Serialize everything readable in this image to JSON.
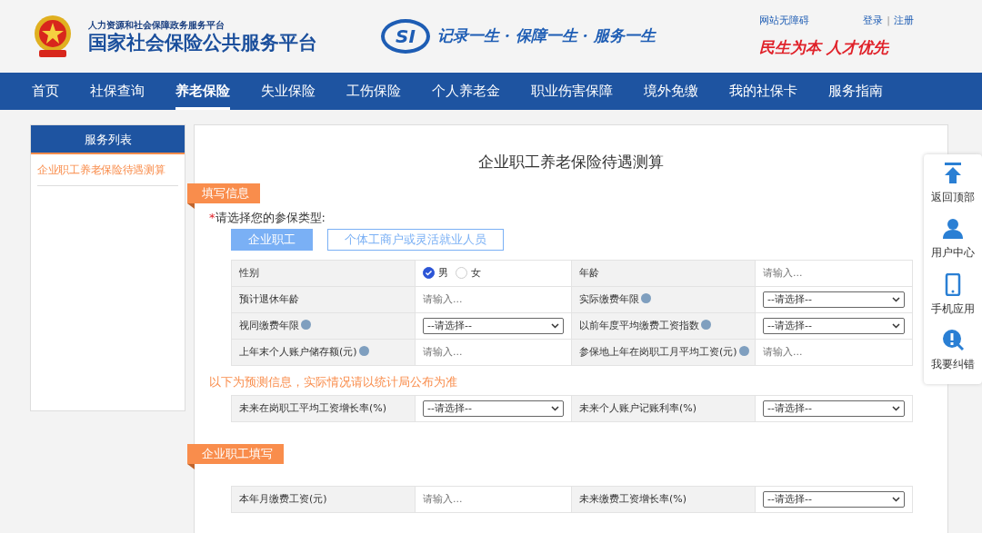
{
  "header": {
    "subtitle": "人力资源和社会保障政务服务平台",
    "title": "国家社会保险公共服务平台",
    "logo_text": "SI",
    "slogan": "记录一生 · 保障一生 · 服务一生",
    "accessibility_link": "网站无障碍",
    "login": "登录",
    "separator": "|",
    "register": "注册",
    "motto": "民生为本 人才优先"
  },
  "nav": [
    {
      "label": "首页",
      "selected": false
    },
    {
      "label": "社保查询",
      "selected": false
    },
    {
      "label": "养老保险",
      "selected": true
    },
    {
      "label": "失业保险",
      "selected": false
    },
    {
      "label": "工伤保险",
      "selected": false
    },
    {
      "label": "个人养老金",
      "selected": false
    },
    {
      "label": "职业伤害保障",
      "selected": false
    },
    {
      "label": "境外免缴",
      "selected": false
    },
    {
      "label": "我的社保卡",
      "selected": false
    },
    {
      "label": "服务指南",
      "selected": false
    }
  ],
  "sidebar": {
    "title": "服务列表",
    "items": [
      {
        "label": "企业职工养老保险待遇测算",
        "selected": true
      }
    ]
  },
  "main": {
    "title": "企业职工养老保险待遇测算",
    "sections": [
      {
        "tag": "填写信息",
        "required_mark": "*",
        "prompt": "请选择您的参保类型:",
        "types": [
          {
            "label": "企业职工",
            "selected": true
          },
          {
            "label": "个体工商户或灵活就业人员",
            "selected": false
          }
        ],
        "tables": [
          {
            "rows": [
              [
                {
                  "label": "性别",
                  "help": false,
                  "kind": "radio",
                  "options": [
                    {
                      "label": "男",
                      "selected": true
                    },
                    {
                      "label": "女",
                      "selected": false
                    }
                  ]
                },
                {
                  "label": "年龄",
                  "help": false,
                  "kind": "input",
                  "placeholder": "请输入..."
                }
              ],
              [
                {
                  "label": "预计退休年龄",
                  "help": false,
                  "kind": "input",
                  "placeholder": "请输入..."
                },
                {
                  "label": "实际缴费年限",
                  "help": true,
                  "kind": "select",
                  "value": "--请选择--"
                }
              ],
              [
                {
                  "label": "视同缴费年限",
                  "help": true,
                  "kind": "select",
                  "value": "--请选择--"
                },
                {
                  "label": "以前年度平均缴费工资指数",
                  "help": true,
                  "kind": "select",
                  "value": "--请选择--"
                }
              ],
              [
                {
                  "label": "上年末个人账户储存额(元)",
                  "help": true,
                  "kind": "input",
                  "placeholder": "请输入..."
                },
                {
                  "label": "参保地上年在岗职工月平均工资(元)",
                  "help": true,
                  "kind": "input",
                  "placeholder": "请输入..."
                }
              ]
            ]
          },
          {
            "notice": "以下为预测信息，实际情况请以统计局公布为准",
            "rows": [
              [
                {
                  "label": "未来在岗职工平均工资增长率(%)",
                  "help": false,
                  "kind": "select",
                  "value": "--请选择--"
                },
                {
                  "label": "未来个人账户记账利率(%)",
                  "help": false,
                  "kind": "select",
                  "value": "--请选择--"
                }
              ]
            ]
          }
        ]
      },
      {
        "tag": "企业职工填写",
        "tables": [
          {
            "rows": [
              [
                {
                  "label": "本年月缴费工资(元)",
                  "help": false,
                  "kind": "input",
                  "placeholder": "请输入..."
                },
                {
                  "label": "未来缴费工资增长率(%)",
                  "help": false,
                  "kind": "select",
                  "value": "--请选择--"
                }
              ]
            ]
          }
        ]
      }
    ]
  },
  "float_panel": [
    {
      "kind": "top",
      "label": "返回顶部"
    },
    {
      "kind": "user",
      "label": "用户中心"
    },
    {
      "kind": "phone",
      "label": "手机应用"
    },
    {
      "kind": "report",
      "label": "我要纠错"
    }
  ]
}
